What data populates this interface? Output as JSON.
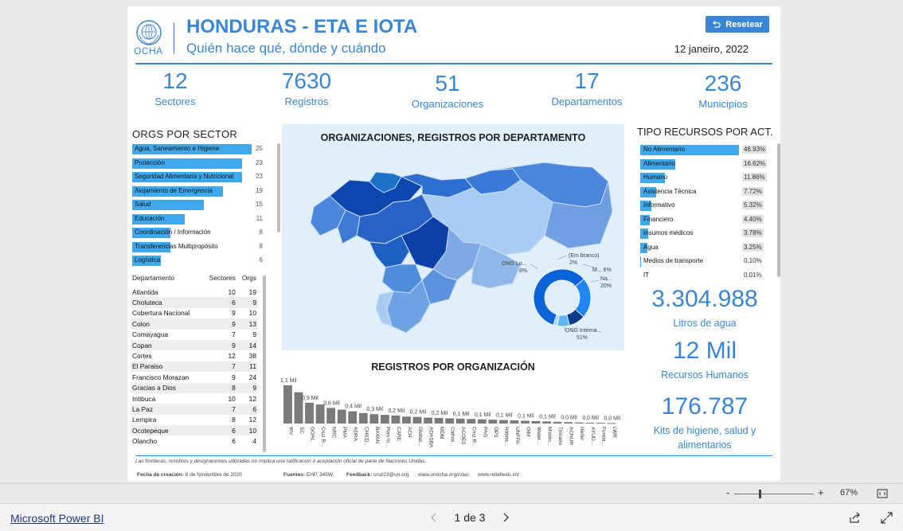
{
  "header": {
    "logo_text": "OCHA",
    "title": "HONDURAS - ETA E IOTA",
    "subtitle": "Quién hace qué, dónde y cuándo",
    "reset_label": "Resetear",
    "date": "12 janeiro, 2022"
  },
  "kpis": [
    {
      "value": "12",
      "label": "Sectores"
    },
    {
      "value": "7630",
      "label": "Registros"
    },
    {
      "value": "51",
      "label": "Organizaciones"
    },
    {
      "value": "17",
      "label": "Departamentos"
    },
    {
      "value": "236",
      "label": "Municipios"
    }
  ],
  "orgs_por_sector": {
    "title": "ORGS POR SECTOR",
    "max": 25,
    "items": [
      {
        "label": "Agua, Saneamiento e Higiene",
        "value": 25
      },
      {
        "label": "Protección",
        "value": 23
      },
      {
        "label": "Seguridad Alimentaria y Nutricional",
        "value": 23
      },
      {
        "label": "Alojamiento de Emergencia",
        "value": 19
      },
      {
        "label": "Salud",
        "value": 15
      },
      {
        "label": "Educación",
        "value": 11
      },
      {
        "label": "Coordinación / Información",
        "value": 8
      },
      {
        "label": "Transferencias Multipropósito",
        "value": 8
      },
      {
        "label": "Logística",
        "value": 6
      }
    ]
  },
  "dept_table": {
    "headers": [
      "Departamento",
      "Sectores",
      "Orgs"
    ],
    "rows": [
      [
        "Atlantida",
        "10",
        "19"
      ],
      [
        "Choluteca",
        "6",
        "9"
      ],
      [
        "Cobertura Nacional",
        "9",
        "10"
      ],
      [
        "Colon",
        "9",
        "13"
      ],
      [
        "Comayagua",
        "7",
        "9"
      ],
      [
        "Copan",
        "9",
        "14"
      ],
      [
        "Cortes",
        "12",
        "38"
      ],
      [
        "El Paraiso",
        "7",
        "11"
      ],
      [
        "Francisco Morazan",
        "9",
        "24"
      ],
      [
        "Gracias a Dios",
        "8",
        "9"
      ],
      [
        "Intibuca",
        "10",
        "12"
      ],
      [
        "La Paz",
        "7",
        "6"
      ],
      [
        "Lempira",
        "8",
        "12"
      ],
      [
        "Ocotepeque",
        "6",
        "10"
      ],
      [
        "Olancho",
        "6",
        "4"
      ]
    ]
  },
  "map": {
    "title": "ORGANIZACIONES, REGISTROS POR DEPARTAMENTO",
    "donut_labels": [
      "(Em branco)",
      "2%",
      "M... 6%",
      "Na...",
      "20%",
      "ONG Lo...",
      "8%",
      "ONG Interna...",
      "51%"
    ],
    "donut_values": [
      51,
      20,
      8,
      6,
      2
    ],
    "colors": [
      "#0a63d8",
      "#1e88f0",
      "#0b3a8a",
      "#5cb6f5",
      "#a8d8ff"
    ]
  },
  "registros": {
    "title": "REGISTROS POR ORGANIZACIÓN",
    "data_labels": [
      "1,1 Mil",
      "0,9 Mil",
      "0,6 Mil",
      "0,4 Mil",
      "0,3 Mil",
      "0,2 Mil",
      "0,2 Mil",
      "0,2 Mil",
      "0,1 Mil",
      "0,1 Mil",
      "0,1 Mil",
      "0,1 Mil",
      "0,1 Mil",
      "0,0 Mil",
      "0,0 Mil",
      "0,0 Mil"
    ]
  },
  "chart_data": {
    "type": "bar",
    "title": "REGISTROS POR ORGANIZACIÓN",
    "categories": [
      "WV",
      "SC",
      "GOAL",
      "Cruz R...",
      "NRC",
      "PMA",
      "ADRA",
      "CHILD...",
      "BAYAN",
      "Plan In...",
      "CARE",
      "ACH",
      "Global...",
      "ADASBA",
      "MDM",
      "Cathol...",
      "ACOES",
      "Cruz R...",
      "PAG",
      "OPS",
      "Hábita...",
      "UNFPA",
      "OIM",
      "Water...",
      "Misión...",
      "Trocaire",
      "ACNUR",
      "Heifer",
      "AYUD...",
      "Funda...",
      "LWR"
    ],
    "values": [
      1100,
      900,
      600,
      550,
      450,
      400,
      350,
      300,
      270,
      250,
      230,
      200,
      190,
      170,
      160,
      150,
      140,
      130,
      120,
      110,
      100,
      90,
      80,
      70,
      60,
      50,
      40,
      30,
      25,
      20,
      15
    ],
    "ylim": [
      0,
      1100
    ]
  },
  "tipo_recursos": {
    "title": "TIPO RECURSOS POR ACT.",
    "items": [
      {
        "label": "No Alimentario",
        "value": "46.93%",
        "pct": 46.93
      },
      {
        "label": "Alimentario",
        "value": "16.62%",
        "pct": 16.62
      },
      {
        "label": "Humano",
        "value": "11.86%",
        "pct": 11.86
      },
      {
        "label": "Asistencia Técnica",
        "value": "7.72%",
        "pct": 7.72
      },
      {
        "label": "Informativo",
        "value": "5.32%",
        "pct": 5.32
      },
      {
        "label": "Financiero",
        "value": "4.40%",
        "pct": 4.4
      },
      {
        "label": "Insumos médicos",
        "value": "3.78%",
        "pct": 3.78
      },
      {
        "label": "Agua",
        "value": "3.25%",
        "pct": 3.25
      },
      {
        "label": "Medios de transporte",
        "value": "0.10%",
        "pct": 0.1
      },
      {
        "label": "IT",
        "value": "0.01%",
        "pct": 0.01
      }
    ]
  },
  "big_numbers": [
    {
      "value": "3.304.988",
      "label": "Litros de agua"
    },
    {
      "value": "12 Mil",
      "label": "Recursos Humanos"
    },
    {
      "value": "176.787",
      "label": "Kits de higiene, salud y alimentarios"
    }
  ],
  "footer": {
    "disclaimer": "Las fronteras, nombres y designaciones utilizadas no implica una ratificación o aceptación oficial de parte de Naciones Unidas.",
    "fecha_label": "Fecha de creación:",
    "fecha_value": "6 de Noviembre de 2020",
    "fuentes_label": "Fuentes:",
    "fuentes_value": "EHP, 345W.",
    "feedback_label": "Feedback:",
    "feedback_value": "cruz23@un.org",
    "link1": "www.unocha.org/rolac",
    "link2": "www.reliefweb.int/"
  },
  "zoom": {
    "minus": "-",
    "plus": "+",
    "level": "67%"
  },
  "bottom": {
    "brand": "Microsoft Power BI",
    "page": "1 de 3"
  }
}
